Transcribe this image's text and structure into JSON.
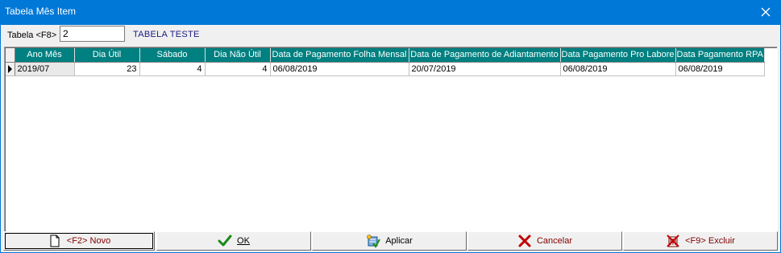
{
  "window": {
    "title": "Tabela Mês Item"
  },
  "filter": {
    "label": "Tabela <F8>",
    "value": "2",
    "description": "TABELA TESTE"
  },
  "grid": {
    "columns": [
      "Ano Mês",
      "Dia Útil",
      "Sábado",
      "Dia Não Útil",
      "Data de Pagamento Folha Mensal",
      "Data de Pagamento de Adiantamento",
      "Data Pagamento Pro Labore",
      "Data Pagamento RPA"
    ],
    "rows": [
      [
        "2019/07",
        "23",
        "4",
        "4",
        "06/08/2019",
        "20/07/2019",
        "06/08/2019",
        "06/08/2019"
      ]
    ]
  },
  "buttons": {
    "novo": "<F2> Novo",
    "ok": "OK",
    "aplicar": "Aplicar",
    "cancelar": "Cancelar",
    "excluir": "<F9> Excluir"
  },
  "icons": {
    "close": "close-icon",
    "novo": "new-document-icon",
    "ok": "checkmark-icon",
    "aplicar": "apply-icon",
    "cancelar": "cancel-x-icon",
    "excluir": "delete-icon"
  },
  "colors": {
    "titlebar": "#0078d7",
    "header": "#008080",
    "ok_check": "#1a8a1a",
    "cancel_x": "#c00000"
  }
}
